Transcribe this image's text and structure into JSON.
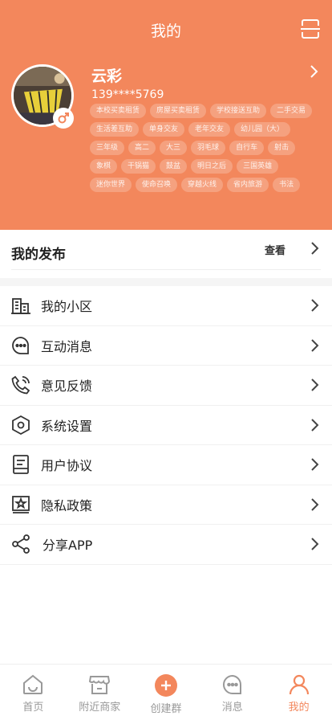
{
  "colors": {
    "accent": "#f3875c",
    "tag_bg": "rgba(255,255,255,0.22)"
  },
  "header": {
    "title": "我的",
    "scan_icon": "scan-icon"
  },
  "profile": {
    "name": "云彩",
    "phone": "139****5769",
    "gender_icon": "male-icon",
    "tags": [
      "本校买卖租赁",
      "房屋买卖租赁",
      "学校接送互助",
      "二手交易",
      "生活差互助",
      "单身交友",
      "老年交友",
      "幼儿园（大）",
      "三年级",
      "高二",
      "大三",
      "羽毛球",
      "自行车",
      "射击",
      "象棋",
      "干锅猫",
      "鼓盆",
      "明日之后",
      "三国英雄",
      "迷你世界",
      "使命召唤",
      "穿越火线",
      "省内旅游",
      "书法"
    ]
  },
  "publish": {
    "title": "我的发布",
    "view_label": "查看"
  },
  "menu": [
    {
      "label": "我的小区",
      "icon": "building-icon"
    },
    {
      "label": "互动消息",
      "icon": "message-icon"
    },
    {
      "label": "意见反馈",
      "icon": "phone-feedback-icon"
    },
    {
      "label": "系统设置",
      "icon": "settings-icon"
    },
    {
      "label": "用户协议",
      "icon": "document-icon"
    },
    {
      "label": "隐私政策",
      "icon": "privacy-icon"
    },
    {
      "label": "分享APP",
      "icon": "share-icon"
    }
  ],
  "tabbar": [
    {
      "label": "首页",
      "icon": "home-icon"
    },
    {
      "label": "附近商家",
      "icon": "shop-icon"
    },
    {
      "label": "创建群",
      "icon": "plus-icon"
    },
    {
      "label": "消息",
      "icon": "chat-icon"
    },
    {
      "label": "我的",
      "icon": "user-icon",
      "active": true
    }
  ]
}
